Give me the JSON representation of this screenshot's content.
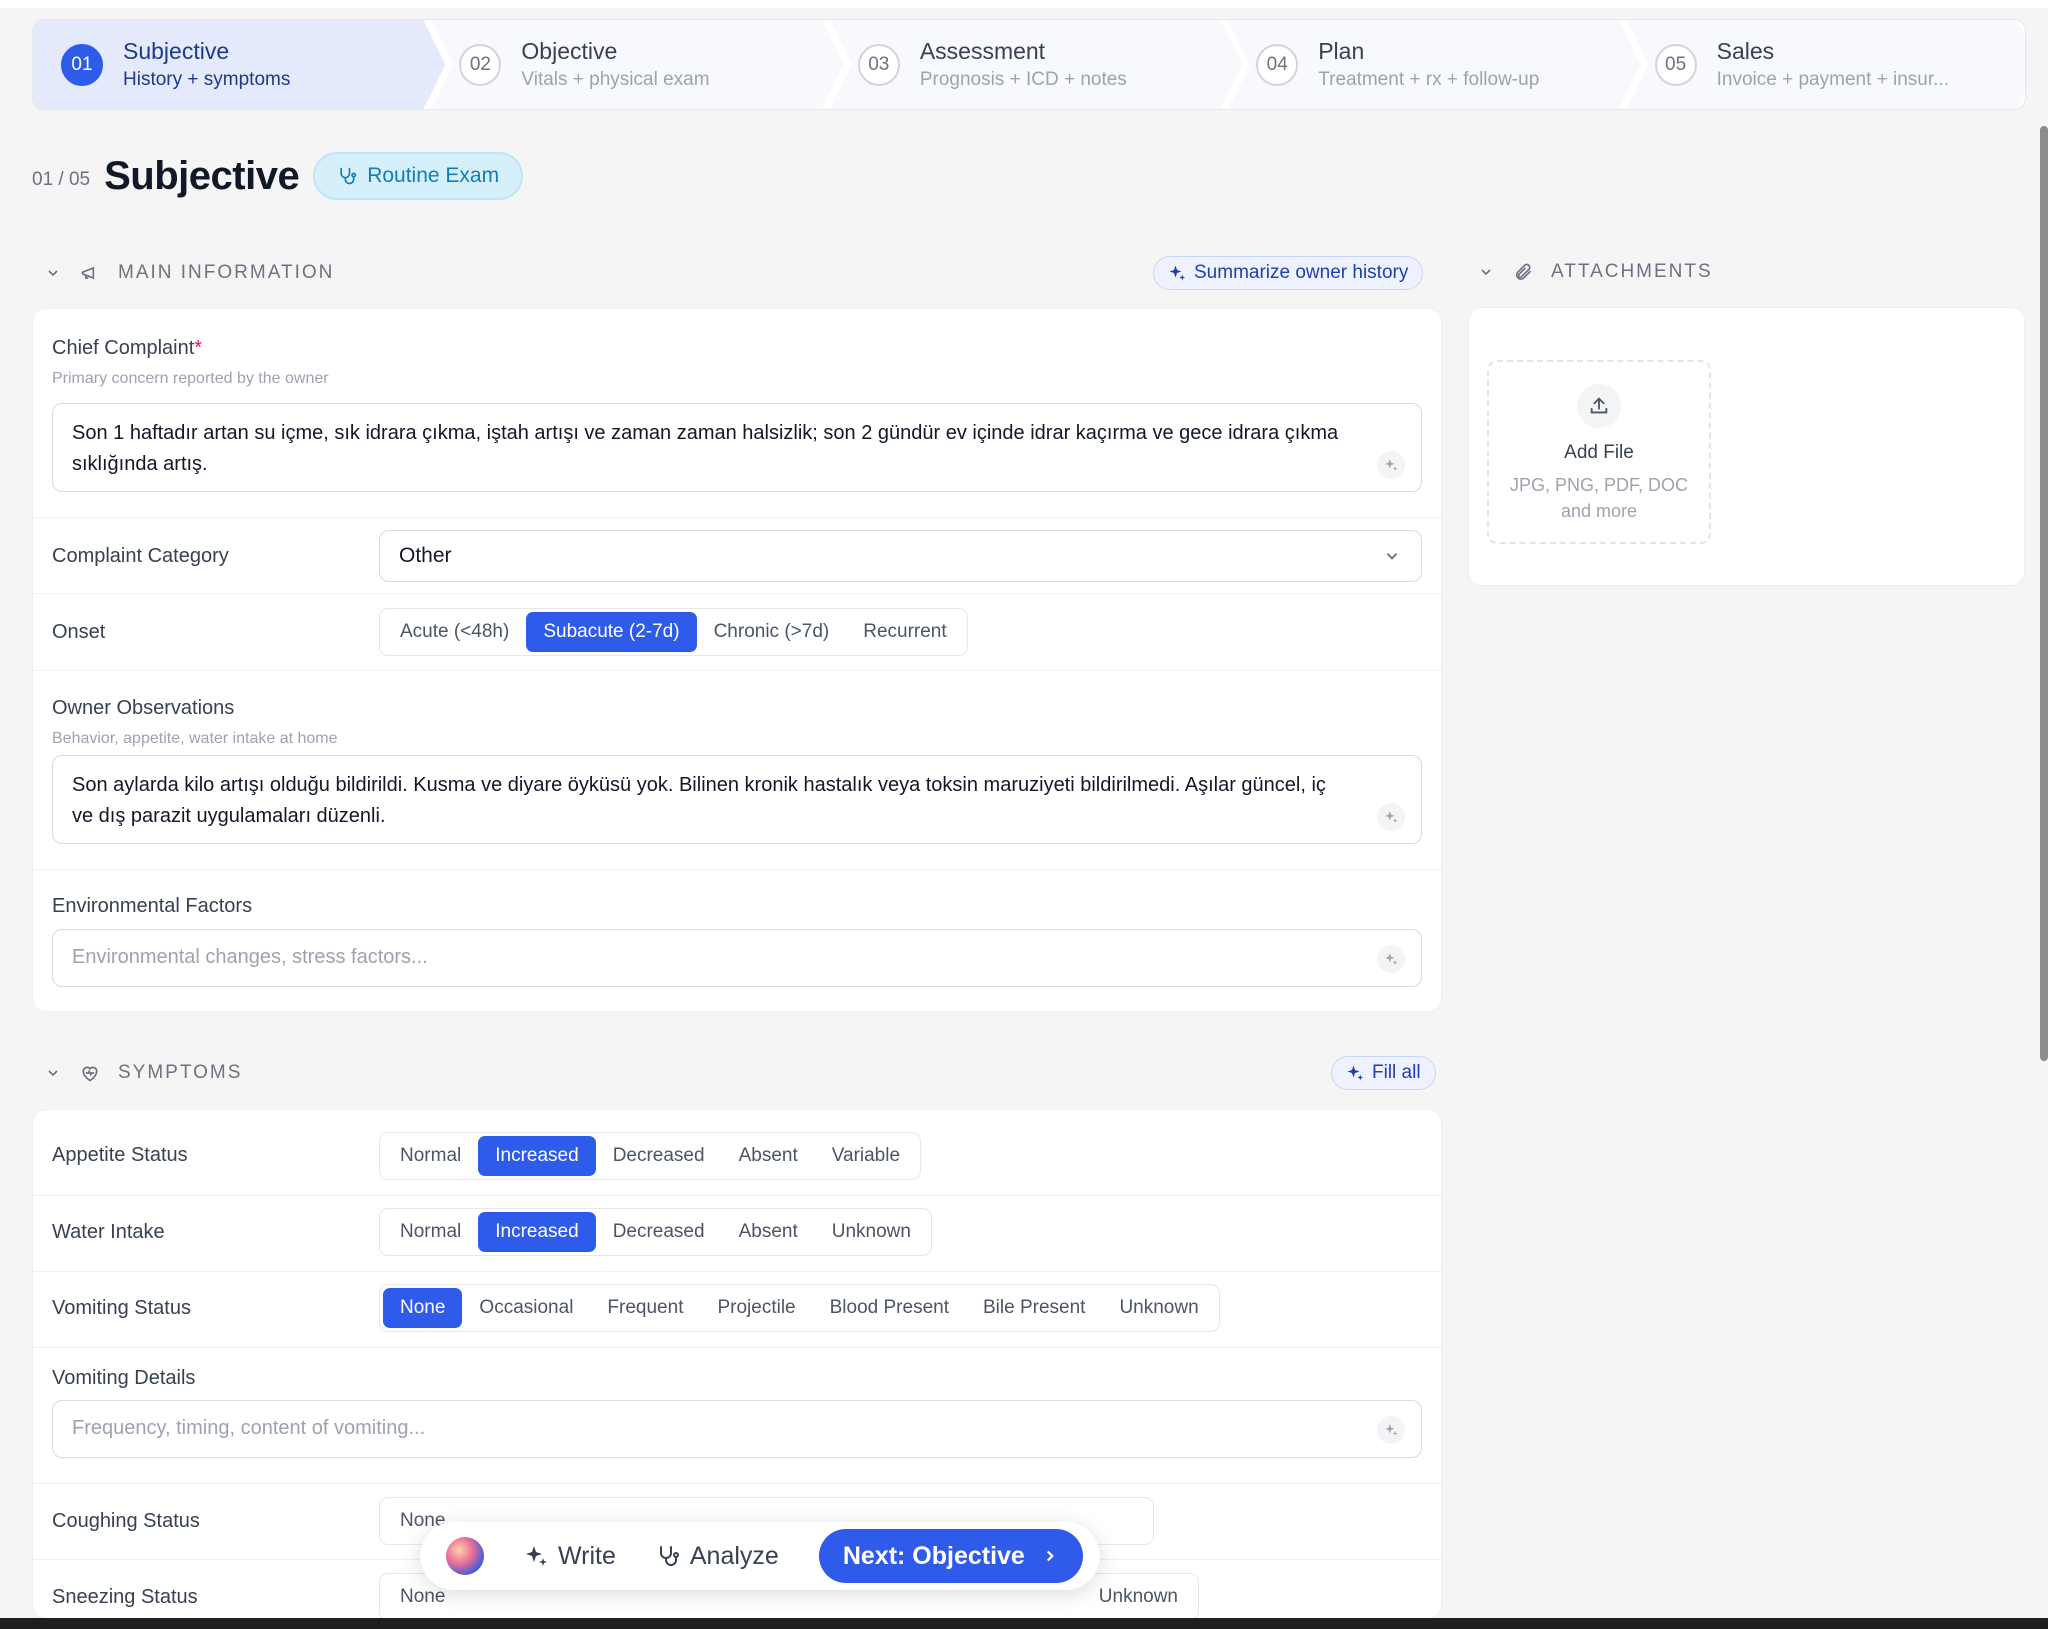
{
  "stepper": [
    {
      "num": "01",
      "title": "Subjective",
      "sub": "History + symptoms",
      "active": true
    },
    {
      "num": "02",
      "title": "Objective",
      "sub": "Vitals + physical exam"
    },
    {
      "num": "03",
      "title": "Assessment",
      "sub": "Prognosis + ICD + notes"
    },
    {
      "num": "04",
      "title": "Plan",
      "sub": "Treatment + rx + follow-up"
    },
    {
      "num": "05",
      "title": "Sales",
      "sub": "Invoice + payment + insur..."
    }
  ],
  "header": {
    "count": "01 / 05",
    "title": "Subjective",
    "badge": "Routine Exam"
  },
  "main_info": {
    "section_title": "MAIN INFORMATION",
    "summarize_label": "Summarize owner history",
    "chief_complaint": {
      "label": "Chief Complaint",
      "required": "*",
      "hint": "Primary concern reported by the owner",
      "value": "Son 1 haftadır artan su içme, sık idrara çıkma, iştah artışı ve zaman zaman halsizlik; son 2 gündür ev içinde idrar kaçırma ve gece idrara çıkma sıklığında artış."
    },
    "complaint_category": {
      "label": "Complaint Category",
      "value": "Other"
    },
    "onset": {
      "label": "Onset",
      "options": [
        "Acute (<48h)",
        "Subacute (2-7d)",
        "Chronic (>7d)",
        "Recurrent"
      ],
      "selected": 1
    },
    "owner_observations": {
      "label": "Owner Observations",
      "hint": "Behavior, appetite, water intake at home",
      "value": "Son aylarda kilo artışı olduğu bildirildi. Kusma ve diyare öyküsü yok. Bilinen kronik hastalık veya toksin maruziyeti bildirilmedi. Aşılar güncel, iç ve dış parazit uygulamaları düzenli."
    },
    "environmental_factors": {
      "label": "Environmental Factors",
      "placeholder": "Environmental changes, stress factors..."
    }
  },
  "attachments": {
    "section_title": "ATTACHMENTS",
    "add_file": "Add File",
    "formats": "JPG, PNG, PDF, DOC and more"
  },
  "symptoms": {
    "section_title": "SYMPTOMS",
    "fill_all": "Fill all",
    "appetite": {
      "label": "Appetite Status",
      "options": [
        "Normal",
        "Increased",
        "Decreased",
        "Absent",
        "Variable"
      ],
      "selected": 1
    },
    "water": {
      "label": "Water Intake",
      "options": [
        "Normal",
        "Increased",
        "Decreased",
        "Absent",
        "Unknown"
      ],
      "selected": 1
    },
    "vomiting": {
      "label": "Vomiting Status",
      "options": [
        "None",
        "Occasional",
        "Frequent",
        "Projectile",
        "Blood Present",
        "Bile Present",
        "Unknown"
      ],
      "selected": 0
    },
    "vomiting_details": {
      "label": "Vomiting Details",
      "placeholder": "Frequency, timing, content of vomiting..."
    },
    "coughing": {
      "label": "Coughing Status",
      "options": [
        "None"
      ]
    },
    "sneezing": {
      "label": "Sneezing Status",
      "options": [
        "None"
      ],
      "last": "Unknown"
    }
  },
  "toolbar": {
    "write": "Write",
    "analyze": "Analyze",
    "next": "Next: Objective"
  },
  "colors": {
    "accent": "#2f5bea",
    "badge_text": "#0e7fb8",
    "required": "#e11d48"
  }
}
